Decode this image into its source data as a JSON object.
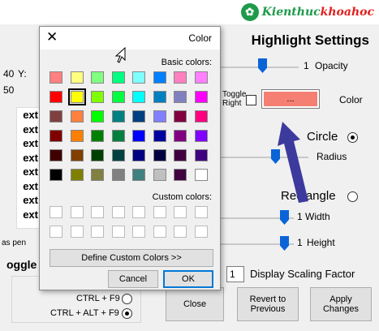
{
  "logo": {
    "text_a": "Kienthuc",
    "text_b": "khoahoc"
  },
  "main": {
    "title": "Highlight Settings",
    "opacity_label": "Opacity",
    "opacity_value": "1",
    "color_label": "Color",
    "color_button_label": "...",
    "toggle_right_label": "Toggle Right",
    "circle_label": "Circle",
    "radius_label": "Radius",
    "rectangle_label": "Rectangle",
    "width_label": "Width",
    "width_value": "1",
    "height_label": "Height",
    "height_value": "1",
    "scaling_label": "Display Scaling Factor",
    "scaling_value": "1",
    "apply_button": "Apply Changes",
    "revert_button": "Revert to Previous",
    "close_button": "Close",
    "toggle_heading": "oggle",
    "toggle_options": [
      "CTRL + F9",
      "CTRL + ALT + F9"
    ],
    "left_y_label": "Y:",
    "left_y_value": "40",
    "left_value2": "50",
    "left_text_items": [
      "ext",
      "ext",
      "ext",
      "ext",
      "ext",
      "ext",
      "ext",
      "ext"
    ],
    "left_side_text": "as pen",
    "accent_color": "#f47f72"
  },
  "dialog": {
    "title": "Color",
    "basic_colors_label": "Basic colors:",
    "custom_colors_label": "Custom colors:",
    "define_custom_button": "Define Custom Colors >>",
    "ok_button": "OK",
    "cancel_button": "Cancel",
    "basic_colors": [
      [
        "#ff8080",
        "#ffff80",
        "#80ff80",
        "#00ff80",
        "#80ffff",
        "#0080ff",
        "#ff80c0",
        "#ff80ff"
      ],
      [
        "#ff0000",
        "#ffff00",
        "#80ff00",
        "#00ff40",
        "#00ffff",
        "#0080c0",
        "#8080c0",
        "#ff00ff"
      ],
      [
        "#804040",
        "#ff8040",
        "#00ff00",
        "#008080",
        "#004080",
        "#8080ff",
        "#800040",
        "#ff0080"
      ],
      [
        "#800000",
        "#ff8000",
        "#008000",
        "#008040",
        "#0000ff",
        "#0000a0",
        "#800080",
        "#8000ff"
      ],
      [
        "#400000",
        "#804000",
        "#004000",
        "#004040",
        "#000080",
        "#000040",
        "#400040",
        "#400080"
      ],
      [
        "#000000",
        "#808000",
        "#808040",
        "#808080",
        "#408080",
        "#c0c0c0",
        "#400040",
        "#ffffff"
      ]
    ],
    "selected_color": "#ffff00"
  }
}
